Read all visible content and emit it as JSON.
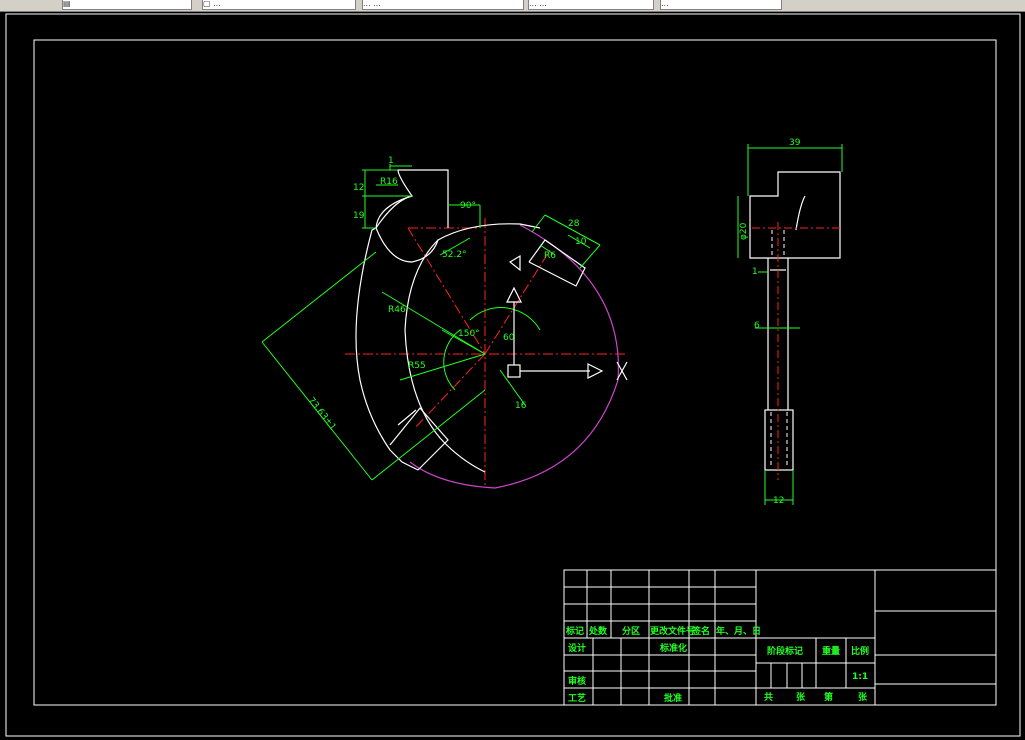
{
  "window": {
    "tabs": [
      {
        "label": "▤"
      },
      {
        "label": "▢ ..."
      },
      {
        "label": "... ..."
      },
      {
        "label": "... ..."
      },
      {
        "label": "..."
      }
    ]
  },
  "colors": {
    "background": "#000000",
    "geometry": "#ffffff",
    "dimension": "#22ff22",
    "centerline": "#ff2222",
    "arc": "#cc44cc"
  },
  "main_view": {
    "dims": {
      "d1": "1",
      "d12": "12",
      "d19": "19",
      "r16": "R16",
      "a90": "90°",
      "a52": "52.2°",
      "r46": "R46",
      "a150": "150°",
      "a60": "60",
      "r55": "R55",
      "d16": "16",
      "d73": "73.63±1",
      "d28": "28",
      "d10": "10",
      "d6": "R6"
    }
  },
  "side_view": {
    "dims": {
      "d39": "39",
      "phi20": "φ20",
      "d1": "1",
      "d6": "6",
      "d12": "12"
    }
  },
  "title_block": {
    "row_labels": [
      "标记",
      "处数",
      "分区",
      "更改文件号",
      "签名",
      "年、月、日"
    ],
    "design": "设计",
    "standard": "标准化",
    "review": "审核",
    "process": "工艺",
    "approve": "批准",
    "stage_mark": "阶段标记",
    "weight": "重量",
    "scale": "比例",
    "scale_value": "1:1",
    "sheets_total": "共",
    "sheets_unit": "张",
    "sheet_no": "第",
    "sheet_unit": "张"
  }
}
